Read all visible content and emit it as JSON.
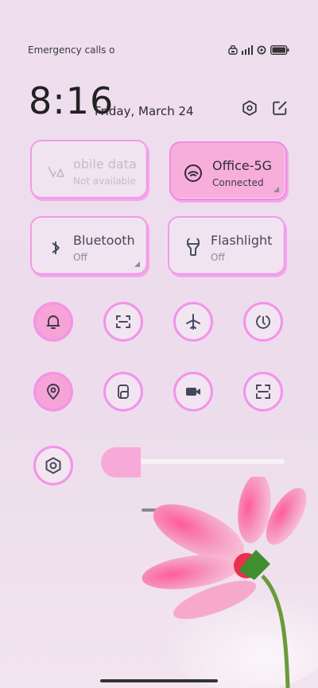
{
  "status_bar": {
    "left_text": "Emergency calls o",
    "icons": [
      "vpn-icon",
      "signal-icon",
      "hotspot-icon",
      "battery-icon"
    ]
  },
  "header": {
    "time": "8:16",
    "date": "Friday, March 24",
    "icons": [
      "settings-icon",
      "edit-icon"
    ]
  },
  "tiles": [
    {
      "id": "mobile-data",
      "label": "obile data",
      "sub": "Not available",
      "icon": "mobile-data-icon",
      "state": "unavailable"
    },
    {
      "id": "wifi",
      "label": "Office-5G",
      "sub": "Connected",
      "icon": "wifi-icon",
      "state": "active"
    },
    {
      "id": "bluetooth",
      "label": "Bluetooth",
      "sub": "Off",
      "icon": "bluetooth-icon",
      "state": "off"
    },
    {
      "id": "flashlight",
      "label": "Flashlight",
      "sub": "Off",
      "icon": "flashlight-icon",
      "state": "off"
    }
  ],
  "toggles": [
    {
      "id": "ring",
      "icon": "bell-icon",
      "on": true
    },
    {
      "id": "screenshot",
      "icon": "screenshot-icon",
      "on": false
    },
    {
      "id": "airplane",
      "icon": "airplane-icon",
      "on": false
    },
    {
      "id": "lock-rotation",
      "icon": "lock-rotation-icon",
      "on": false
    },
    {
      "id": "location",
      "icon": "location-icon",
      "on": true
    },
    {
      "id": "screen-cast",
      "icon": "screen-cast-icon",
      "on": false
    },
    {
      "id": "screen-recorder",
      "icon": "video-icon",
      "on": false
    },
    {
      "id": "scanner",
      "icon": "scan-icon",
      "on": false
    }
  ],
  "brightness": {
    "icon": "settings-icon",
    "level": 0.2
  },
  "colors": {
    "accent": "#f28ae0",
    "active_fill": "#f7aeda",
    "background": "#ecdcec"
  }
}
